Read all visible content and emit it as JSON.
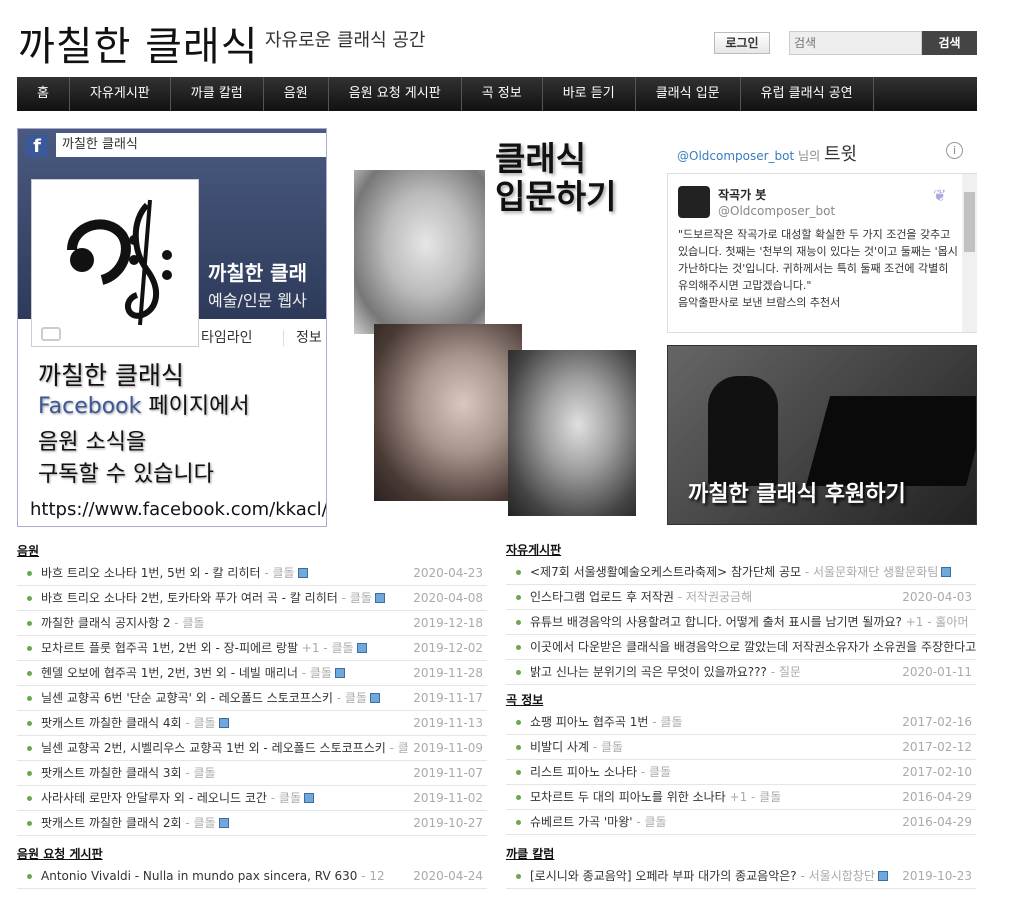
{
  "header": {
    "logo": "까칠한 클래식",
    "tagline": "자유로운 클래식 공간",
    "login_label": "로그인",
    "search_placeholder": "검색",
    "search_button": "검색"
  },
  "nav": [
    "홈",
    "자유게시판",
    "까클 칼럼",
    "음원",
    "음원 요청 게시판",
    "곡 정보",
    "바로 듣기",
    "클래식 입문",
    "유럽 클래식 공연"
  ],
  "facebook": {
    "search_text": "까칠한 클래식",
    "page_name": "까칠한 클래",
    "category": "예술/인문 웹사",
    "tab_timeline": "타임라인",
    "tab_info": "정보",
    "promo_line1": "까칠한 클래식",
    "promo_line2_brand": "Facebook",
    "promo_line2_rest": " 페이지에서",
    "promo_line3": "음원 소식을",
    "promo_line4": "구독할 수 있습니다",
    "url": "https://www.facebook.com/kkacl/"
  },
  "classic_intro": {
    "line1": "클래식",
    "line2": "입문하기"
  },
  "twitter": {
    "handle_link": "@Oldcomposer_bot",
    "suffix": "님의",
    "title": "트윗",
    "info_icon": "i",
    "name": "작곡가 봇",
    "handle": "@Oldcomposer_bot",
    "text": "\"드보르작은 작곡가로 대성할 확실한 두 가지 조건을 갖추고 있습니다. 첫째는 '천부의 재능이 있다는 것'이고 둘째는 '몹시 가난하다는 것'입니다. 귀하께서는 특히 둘째 조건에 각별히 유의해주시면 고맙겠습니다.\"",
    "text2": "음악출판사로 보낸 브람스의 추천서"
  },
  "sponsor": {
    "label": "까칠한 클래식 후원하기"
  },
  "sections": {
    "music": {
      "title": "음원",
      "rows": [
        {
          "title": "바흐 트리오 소나타 1번, 5번 외 - 칼 리히터",
          "author": " - 클돌",
          "disk": true,
          "date": "2020-04-23"
        },
        {
          "title": "바흐 트리오 소나타 2번, 토카타와 푸가 여러 곡 - 칼 리히터",
          "author": " - 클돌",
          "disk": true,
          "date": "2020-04-08"
        },
        {
          "title": "까칠한 클래식 공지사항 2",
          "author": " - 클돌",
          "disk": false,
          "date": "2019-12-18"
        },
        {
          "title": "모차르트 플룻 협주곡 1번, 2번 외 - 장-피에르 랑팔",
          "author": "  +1 - 클돌",
          "disk": true,
          "date": "2019-12-02"
        },
        {
          "title": "헨델 오보에 협주곡 1번, 2번, 3번 외 - 네빌 매리너",
          "author": " - 클돌",
          "disk": true,
          "date": "2019-11-28"
        },
        {
          "title": "닐센 교향곡 6번 '단순 교향곡' 외 - 레오폴드 스토코프스키",
          "author": " - 클돌",
          "disk": true,
          "date": "2019-11-17"
        },
        {
          "title": "팟캐스트 까칠한 클래식 4회",
          "author": " - 클돌",
          "disk": true,
          "date": "2019-11-13"
        },
        {
          "title": "닐센 교향곡 2번, 시벨리우스 교향곡 1번 외 - 레오폴드 스토코프스키",
          "author": " - 클돌",
          "disk": true,
          "date": "2019-11-09"
        },
        {
          "title": "팟캐스트 까칠한 클래식 3회",
          "author": " - 클돌",
          "disk": false,
          "date": "2019-11-07"
        },
        {
          "title": "사라사테 로만자 안달루자 외 - 레오니드 코간",
          "author": " - 클돌",
          "disk": true,
          "date": "2019-11-02"
        },
        {
          "title": "팟캐스트 까칠한 클래식 2회",
          "author": " - 클돌",
          "disk": true,
          "date": "2019-10-27"
        }
      ]
    },
    "free": {
      "title": "자유게시판",
      "rows": [
        {
          "title": "<제7회 서울생활예술오케스트라축제> 참가단체 공모",
          "author": " - 서울문화재단 생활문화팀",
          "disk": true,
          "date": ""
        },
        {
          "title": "인스타그램 업로드 후 저작권",
          "author": " - 저작권궁금해",
          "disk": false,
          "date": "2020-04-03"
        },
        {
          "title": "유튜브 배경음악의 사용할려고 합니다. 어떻게 출처 표시를 남기면 될까요?",
          "author": " +1 - 홀아머",
          "disk": false,
          "date": ""
        },
        {
          "title": "이곳에서 다운받은 클래식을 배경음악으로 깔았는데 저작권소유자가 소유권을 주장한다고 예외인 아니오",
          "author": "",
          "disk": false,
          "date": ""
        },
        {
          "title": "밝고 신나는 분위기의 곡은 무엇이 있을까요???",
          "author": " - 질문",
          "disk": false,
          "date": "2020-01-11"
        }
      ]
    },
    "info": {
      "title": "곡 정보",
      "rows": [
        {
          "title": "쇼팽 피아노 협주곡 1번",
          "author": " - 클돌",
          "disk": false,
          "date": "2017-02-16"
        },
        {
          "title": "비발디 사계",
          "author": " - 클돌",
          "disk": false,
          "date": "2017-02-12"
        },
        {
          "title": "리스트 피아노 소나타",
          "author": " - 클돌",
          "disk": false,
          "date": "2017-02-10"
        },
        {
          "title": "모차르트 두 대의 피아노를 위한 소나타",
          "author": "  +1 - 클돌",
          "disk": false,
          "date": "2016-04-29"
        },
        {
          "title": "슈베르트 가곡 '마왕'",
          "author": " - 클돌",
          "disk": false,
          "date": "2016-04-29"
        }
      ]
    },
    "request": {
      "title": "음원 요청 게시판",
      "rows": [
        {
          "title": "Antonio Vivaldi - Nulla in mundo pax sincera, RV 630",
          "author": " - 12",
          "disk": false,
          "date": "2020-04-24"
        }
      ]
    },
    "column": {
      "title": "까클 칼럼",
      "rows": [
        {
          "title": "[로시니와 종교음악] 오페라 부파 대가의 종교음악은?",
          "author": " - 서울시합창단",
          "disk": true,
          "date": "2019-10-23"
        }
      ]
    }
  },
  "colors": {
    "nav_bg": "#1a1a1a",
    "bullet": "#6aa84f",
    "link_blue": "#3a7bbf",
    "facebook_blue": "#3b5998"
  },
  "icons": [
    "facebook-icon",
    "camera-icon",
    "info-icon",
    "twitter-bird-icon",
    "floppy-disk-icon"
  ]
}
